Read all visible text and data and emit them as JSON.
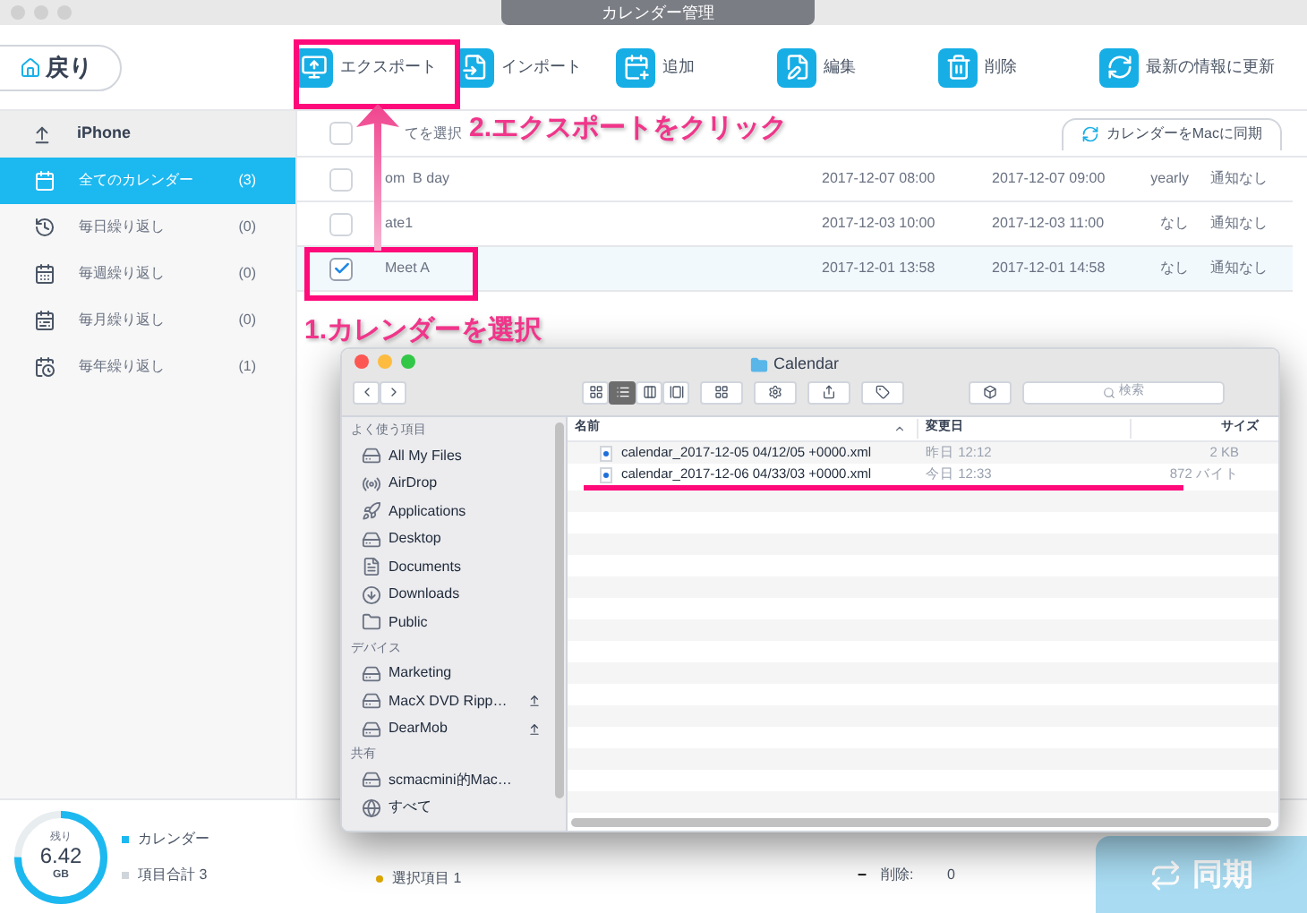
{
  "window": {
    "title": "カレンダー管理"
  },
  "back_button": {
    "label": "戻り"
  },
  "toolbar": [
    {
      "label": "エクスポート",
      "kind": "export"
    },
    {
      "label": "インポート",
      "kind": "import"
    },
    {
      "label": "追加",
      "kind": "add"
    },
    {
      "label": "編集",
      "kind": "edit"
    },
    {
      "label": "削除",
      "kind": "delete"
    },
    {
      "label": "最新の情報に更新",
      "kind": "refresh"
    }
  ],
  "sidebar": {
    "device": "iPhone",
    "items": [
      {
        "label": "全てのカレンダー",
        "count": "(3)",
        "selected": true,
        "kind": "all"
      },
      {
        "label": "毎日繰り返し",
        "count": "(0)",
        "selected": false,
        "kind": "daily"
      },
      {
        "label": "毎週繰り返し",
        "count": "(0)",
        "selected": false,
        "kind": "weekly"
      },
      {
        "label": "毎月繰り返し",
        "count": "(0)",
        "selected": false,
        "kind": "monthly"
      },
      {
        "label": "毎年繰り返し",
        "count": "(1)",
        "selected": false,
        "kind": "yearly"
      }
    ]
  },
  "list": {
    "select_all": {
      "label": "てを選択",
      "checked": false
    },
    "sync_tab": "カレンダーをMacに同期",
    "rows": [
      {
        "title": "om  B day",
        "start": "2017-12-07 08:00",
        "end": "2017-12-07 09:00",
        "repeat": "yearly",
        "alert": "通知なし",
        "checked": false,
        "selected": false
      },
      {
        "title": "ate1",
        "start": "2017-12-03 10:00",
        "end": "2017-12-03 11:00",
        "repeat": "なし",
        "alert": "通知なし",
        "checked": false,
        "selected": false
      },
      {
        "title": "Meet A",
        "start": "2017-12-01 13:58",
        "end": "2017-12-01 14:58",
        "repeat": "なし",
        "alert": "通知なし",
        "checked": true,
        "selected": true
      }
    ]
  },
  "storage": {
    "label": "残り",
    "value": "6.42",
    "unit": "GB",
    "level": 0.75
  },
  "legend": [
    {
      "label": "カレンダー",
      "color": "#1cb8f0"
    },
    {
      "label": "項目合計 3",
      "color": "#cfd5db"
    }
  ],
  "status": {
    "selected": "選択項目 1",
    "dash": "–",
    "deleted_label": "削除:",
    "deleted_count": "0"
  },
  "sync_button": {
    "label": "同期"
  },
  "finder": {
    "title": "Calendar",
    "search_placeholder": "検索",
    "sections": [
      {
        "heading": "よく使う項目",
        "items": [
          {
            "label": "All My Files",
            "kind": "drive",
            "eject": false
          },
          {
            "label": "AirDrop",
            "kind": "airdrop",
            "eject": false
          },
          {
            "label": "Applications",
            "kind": "apps",
            "eject": false
          },
          {
            "label": "Desktop",
            "kind": "drive",
            "eject": false
          },
          {
            "label": "Documents",
            "kind": "docs",
            "eject": false
          },
          {
            "label": "Downloads",
            "kind": "download",
            "eject": false
          },
          {
            "label": "Public",
            "kind": "folder",
            "eject": false
          }
        ]
      },
      {
        "heading": "デバイス",
        "items": [
          {
            "label": "Marketing",
            "kind": "disk",
            "eject": false
          },
          {
            "label": "MacX DVD Ripp…",
            "kind": "drive",
            "eject": true
          },
          {
            "label": "DearMob",
            "kind": "drive",
            "eject": true
          }
        ]
      },
      {
        "heading": "共有",
        "items": [
          {
            "label": "scmacmini的Mac…",
            "kind": "disk",
            "eject": false
          },
          {
            "label": "すべて",
            "kind": "globe",
            "eject": false
          }
        ]
      }
    ],
    "columns": [
      "名前",
      "変更日",
      "サイズ"
    ],
    "files": [
      {
        "name": "calendar_2017-12-05 04/12/05 +0000.xml",
        "modified": "昨日 12:12",
        "size": "2 KB",
        "underlined": false
      },
      {
        "name": "calendar_2017-12-06 04/33/03 +0000.xml",
        "modified": "今日 12:33",
        "size": "872 バイト",
        "underlined": true
      }
    ]
  },
  "annotations": {
    "step1": "1.カレンダーを選択",
    "step2": "2.エクスポートをクリック"
  }
}
